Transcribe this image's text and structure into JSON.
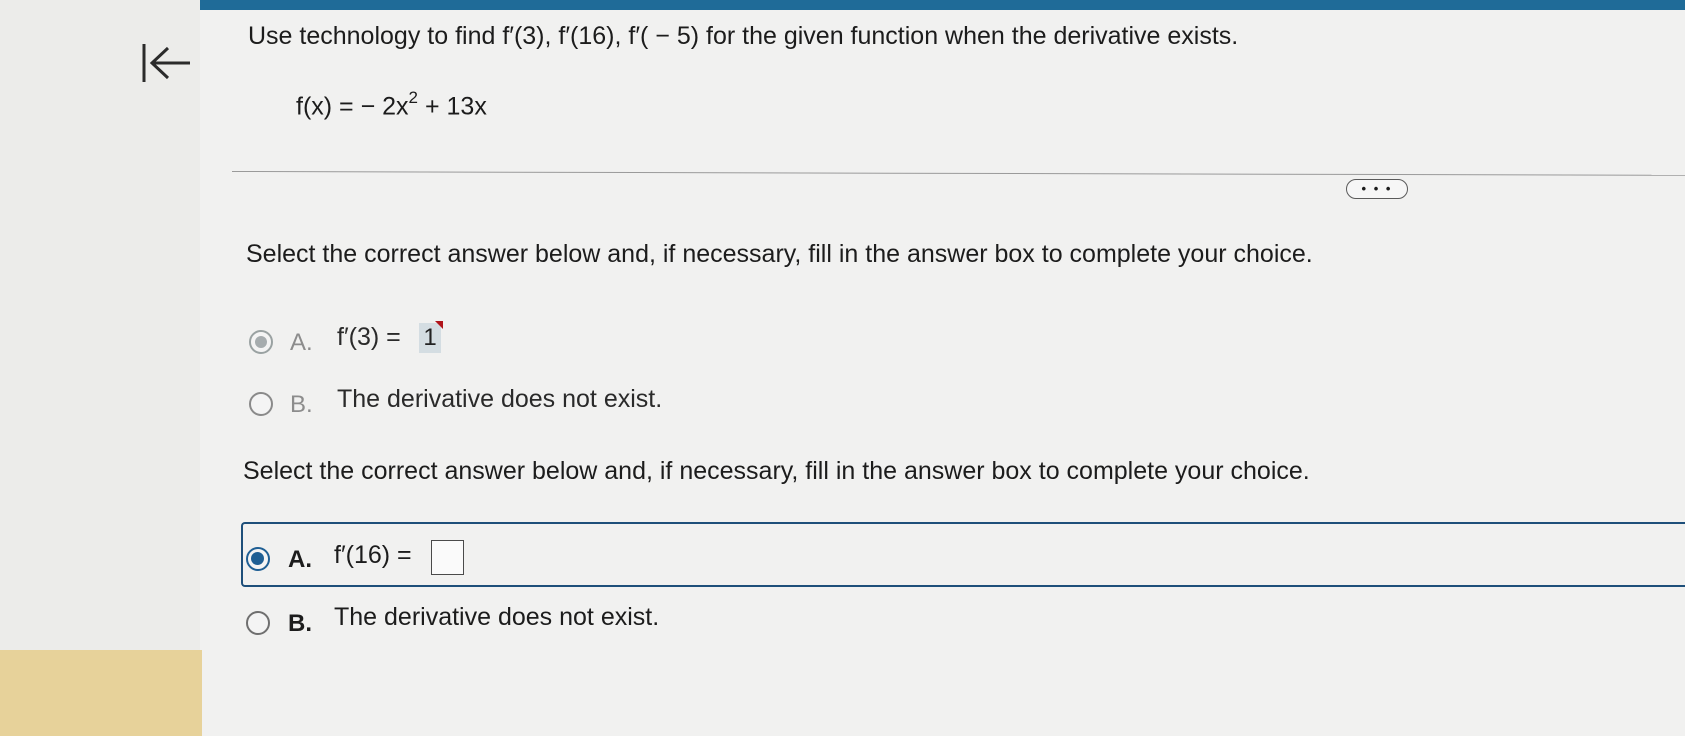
{
  "question": {
    "text": "Use technology to find f′(3), f′(16), f′( − 5) for the given function when the derivative exists.",
    "function_prefix": "f(x) = − 2x",
    "function_exponent": "2",
    "function_suffix": " + 13x"
  },
  "more_button_label": "• • •",
  "part1": {
    "instruction": "Select the correct answer below and, if necessary, fill in the answer box to complete your choice.",
    "option_a": {
      "letter": "A.",
      "text": "f′(3) =",
      "answer": "1",
      "state": "selected-submitted"
    },
    "option_b": {
      "letter": "B.",
      "text": "The derivative does not exist.",
      "state": "unselected"
    }
  },
  "part2": {
    "instruction": "Select the correct answer below and, if necessary, fill in the answer box to complete your choice.",
    "option_a": {
      "letter": "A.",
      "text": "f′(16) =",
      "answer": "",
      "state": "selected-active"
    },
    "option_b": {
      "letter": "B.",
      "text": "The derivative does not exist.",
      "state": "unselected"
    }
  },
  "colors": {
    "accent": "#1f5f94",
    "top_bar": "#1f6b98",
    "incorrect_mark": "#b0141a",
    "side_highlight": "#e7d29a"
  },
  "icons": {
    "back": "first-page-icon"
  }
}
